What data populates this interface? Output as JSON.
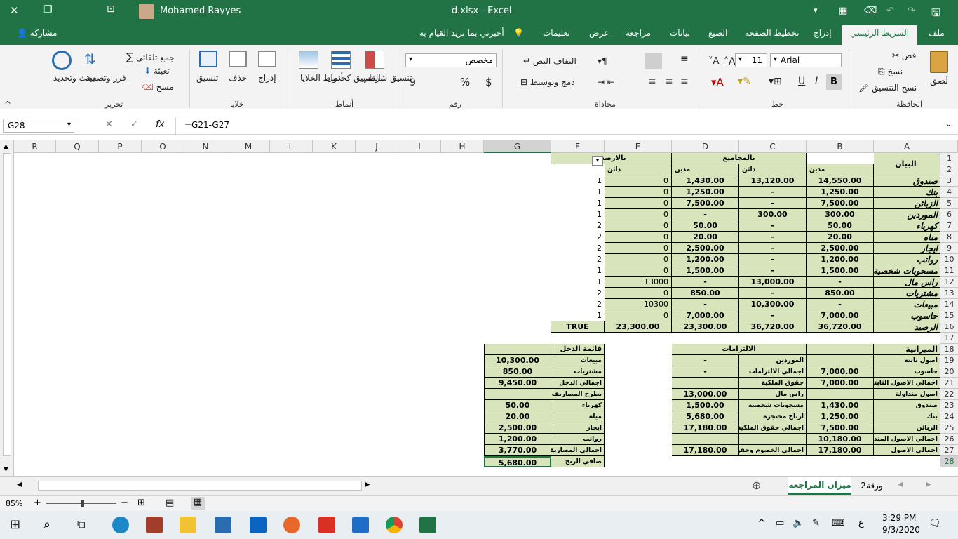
{
  "title_bar": {
    "user_name": "Mohamed Rayyes",
    "doc_title": "d.xlsx  -  Excel"
  },
  "tabs": {
    "file": "ملف",
    "home": "الشريط الرئيسي",
    "insert": "إدراج",
    "page_layout": "تخطيط الصفحة",
    "formulas": "الصيغ",
    "data": "بيانات",
    "review": "مراجعة",
    "view": "عرض",
    "help": "تعليمات",
    "tell_me": "أخبرني بما تريد القيام به",
    "share": "مشاركة"
  },
  "ribbon": {
    "clipboard": {
      "label": "الحافظة",
      "paste": "لصق",
      "cut": "قص",
      "copy": "نسخ",
      "format_painter": "نسخ التنسيق"
    },
    "font": {
      "label": "خط",
      "name": "Arial",
      "size": "11",
      "bold": "B",
      "italic": "I",
      "underline": "U"
    },
    "alignment": {
      "label": "محاذاة",
      "wrap": "التفاف النص",
      "merge": "دمج وتوسيط"
    },
    "number": {
      "label": "رقم",
      "format": "مخصص",
      "currency": "$",
      "percent": "%",
      "comma": "9"
    },
    "styles": {
      "label": "أنماط",
      "conditional": "تنسيق شرطي",
      "table": "التنسيق كجدول",
      "cell_styles": "أنماط الخلايا"
    },
    "cells": {
      "label": "خلايا",
      "insert": "إدراج",
      "delete": "حذف",
      "format": "تنسيق"
    },
    "editing": {
      "label": "تحرير",
      "autosum": "جمع تلقائي",
      "fill": "تعبئة",
      "clear": "مسح",
      "sort": "فرز وتصفية",
      "find": "بحث وتحديد"
    }
  },
  "formula_bar": {
    "name_box": "G28",
    "fx": "fx",
    "formula": "=G21-G27"
  },
  "columns": [
    "A",
    "B",
    "C",
    "D",
    "E",
    "F",
    "G",
    "H",
    "I",
    "J",
    "K",
    "L",
    "M",
    "N",
    "O",
    "P",
    "Q",
    "R"
  ],
  "rows": [
    "1",
    "2",
    "3",
    "4",
    "5",
    "6",
    "7",
    "8",
    "9",
    "10",
    "11",
    "12",
    "13",
    "14",
    "15",
    "16",
    "17",
    "18",
    "19",
    "20",
    "21",
    "22",
    "23",
    "24",
    "25",
    "26",
    "27",
    "28"
  ],
  "trial_balance": {
    "header_item": "البيان",
    "header_totals": "بالمجاميع",
    "header_balances": "بالارصدة",
    "debit": "مدين",
    "credit": "دائن",
    "rows": [
      {
        "a": "صندوق",
        "b": "14,550.00",
        "c": "13,120.00",
        "d": "1,430.00",
        "e": "0",
        "f": "1"
      },
      {
        "a": "بنك",
        "b": "1,250.00",
        "c": "-",
        "d": "1,250.00",
        "e": "0",
        "f": "1"
      },
      {
        "a": "الزبائن",
        "b": "7,500.00",
        "c": "-",
        "d": "7,500.00",
        "e": "0",
        "f": "1"
      },
      {
        "a": "الموردين",
        "b": "300.00",
        "c": "300.00",
        "d": "-",
        "e": "0",
        "f": "1"
      },
      {
        "a": "كهرباء",
        "b": "50.00",
        "c": "-",
        "d": "50.00",
        "e": "0",
        "f": "2"
      },
      {
        "a": "مياه",
        "b": "20.00",
        "c": "-",
        "d": "20.00",
        "e": "0",
        "f": "2"
      },
      {
        "a": "ايجار",
        "b": "2,500.00",
        "c": "-",
        "d": "2,500.00",
        "e": "0",
        "f": "2"
      },
      {
        "a": "رواتب",
        "b": "1,200.00",
        "c": "-",
        "d": "1,200.00",
        "e": "0",
        "f": "2"
      },
      {
        "a": "مسحوبات شخصية",
        "b": "1,500.00",
        "c": "-",
        "d": "1,500.00",
        "e": "0",
        "f": "1"
      },
      {
        "a": "راس مال",
        "b": "-",
        "c": "13,000.00",
        "d": "-",
        "e": "13000",
        "f": "1"
      },
      {
        "a": "مشتريات",
        "b": "850.00",
        "c": "-",
        "d": "850.00",
        "e": "0",
        "f": "2"
      },
      {
        "a": "مبيعات",
        "b": "-",
        "c": "10,300.00",
        "d": "-",
        "e": "10300",
        "f": "2"
      },
      {
        "a": "حاسوب",
        "b": "7,000.00",
        "c": "-",
        "d": "7,000.00",
        "e": "0",
        "f": "1"
      },
      {
        "a": "الرصيد",
        "b": "36,720.00",
        "c": "36,720.00",
        "d": "23,300.00",
        "e": "23,300.00",
        "f": "TRUE"
      }
    ]
  },
  "balance_sheet": {
    "assets_header": "الميزانية",
    "liabilities_header": "الالتزامات",
    "rows": [
      {
        "a": "اصول ثابتة",
        "b": "",
        "c": "الموردين",
        "d": "-"
      },
      {
        "a": "حاسوب",
        "b": "7,000.00",
        "c": "اجمالي الالتزامات",
        "d": "-"
      },
      {
        "a": "اجمالي الاصول الثابتة",
        "b": "7,000.00",
        "c": "حقوق الملكية",
        "d": ""
      },
      {
        "a": "اصول متداولة",
        "b": "",
        "c": "راس مال",
        "d": "13,000.00"
      },
      {
        "a": "صندوق",
        "b": "1,430.00",
        "c": "مسحوبات شخصية",
        "d": "1,500.00"
      },
      {
        "a": "بنك",
        "b": "1,250.00",
        "c": "ارباح محتجزة",
        "d": "5,680.00"
      },
      {
        "a": "الزبائن",
        "b": "7,500.00",
        "c": "اجمالي حقوق الملكية",
        "d": "17,180.00"
      },
      {
        "a": "اجمالي الاصول المتداولة",
        "b": "10,180.00",
        "c": "",
        "d": ""
      },
      {
        "a": "اجمالي الاصول",
        "b": "17,180.00",
        "c": "اجمالي الخصوم وحقوق",
        "d": "17,180.00"
      }
    ]
  },
  "income_statement": {
    "header": "قائمة الدخل",
    "rows": [
      {
        "f": "مبيعات",
        "g": "10,300.00"
      },
      {
        "f": "مشتريات",
        "g": "850.00"
      },
      {
        "f": "اجمالي الدخل",
        "g": "9,450.00"
      },
      {
        "f": "يطرح المصاريف",
        "g": ""
      },
      {
        "f": "كهرباء",
        "g": "50.00"
      },
      {
        "f": "مياه",
        "g": "20.00"
      },
      {
        "f": "ايجار",
        "g": "2,500.00"
      },
      {
        "f": "رواتب",
        "g": "1,200.00"
      },
      {
        "f": "اجمالي المصاريف",
        "g": "3,770.00"
      },
      {
        "f": "صافي الربح",
        "g": "5,680.00"
      }
    ]
  },
  "sheets": {
    "active": "ميزان المراجعة",
    "other": "ورقة2"
  },
  "status": {
    "zoom": "85%"
  },
  "taskbar": {
    "time": "3:29 PM",
    "date": "9/3/2020",
    "lang": "ع"
  },
  "colors": {
    "excel_green": "#217346",
    "cell_green": "#d8e4bc"
  }
}
